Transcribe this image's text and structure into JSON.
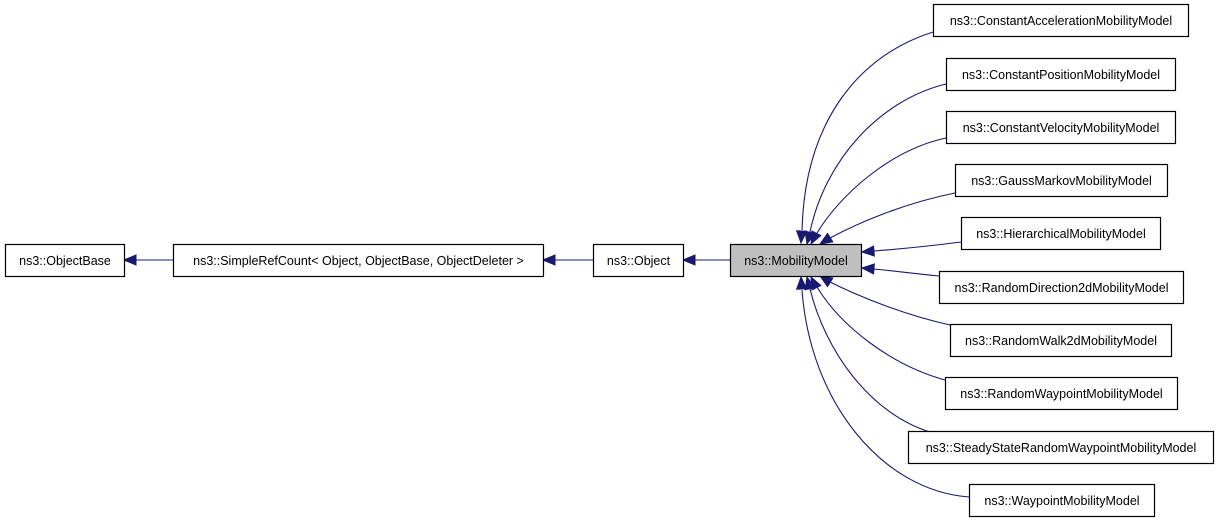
{
  "diagram": {
    "type": "class-inheritance-graph",
    "focus_class": "ns3::MobilityModel",
    "colors": {
      "edge": "#191970",
      "node_fill": "#ffffff",
      "focus_fill": "#bfbfbf",
      "node_border": "#000000"
    },
    "nodes": [
      {
        "id": "objectbase",
        "label": "ns3::ObjectBase"
      },
      {
        "id": "simplerefcount",
        "label": "ns3::SimpleRefCount< Object, ObjectBase, ObjectDeleter >"
      },
      {
        "id": "object",
        "label": "ns3::Object"
      },
      {
        "id": "mobilitymodel",
        "label": "ns3::MobilityModel",
        "focus": true
      },
      {
        "id": "constantacceleration",
        "label": "ns3::ConstantAccelerationMobilityModel"
      },
      {
        "id": "constantposition",
        "label": "ns3::ConstantPositionMobilityModel"
      },
      {
        "id": "constantvelocity",
        "label": "ns3::ConstantVelocityMobilityModel"
      },
      {
        "id": "gaussmarkov",
        "label": "ns3::GaussMarkovMobilityModel"
      },
      {
        "id": "hierarchical",
        "label": "ns3::HierarchicalMobilityModel"
      },
      {
        "id": "randomdirection2d",
        "label": "ns3::RandomDirection2dMobilityModel"
      },
      {
        "id": "randomwalk2d",
        "label": "ns3::RandomWalk2dMobilityModel"
      },
      {
        "id": "randomwaypoint",
        "label": "ns3::RandomWaypointMobilityModel"
      },
      {
        "id": "steadystaterandomwaypoint",
        "label": "ns3::SteadyStateRandomWaypointMobilityModel"
      },
      {
        "id": "waypoint",
        "label": "ns3::WaypointMobilityModel"
      }
    ],
    "edges": [
      {
        "from": "simplerefcount",
        "to": "objectbase",
        "relation": "inherits"
      },
      {
        "from": "object",
        "to": "simplerefcount",
        "relation": "inherits"
      },
      {
        "from": "mobilitymodel",
        "to": "object",
        "relation": "inherits"
      },
      {
        "from": "constantacceleration",
        "to": "mobilitymodel",
        "relation": "inherits"
      },
      {
        "from": "constantposition",
        "to": "mobilitymodel",
        "relation": "inherits"
      },
      {
        "from": "constantvelocity",
        "to": "mobilitymodel",
        "relation": "inherits"
      },
      {
        "from": "gaussmarkov",
        "to": "mobilitymodel",
        "relation": "inherits"
      },
      {
        "from": "hierarchical",
        "to": "mobilitymodel",
        "relation": "inherits"
      },
      {
        "from": "randomdirection2d",
        "to": "mobilitymodel",
        "relation": "inherits"
      },
      {
        "from": "randomwalk2d",
        "to": "mobilitymodel",
        "relation": "inherits"
      },
      {
        "from": "randomwaypoint",
        "to": "mobilitymodel",
        "relation": "inherits"
      },
      {
        "from": "steadystaterandomwaypoint",
        "to": "mobilitymodel",
        "relation": "inherits"
      },
      {
        "from": "waypoint",
        "to": "mobilitymodel",
        "relation": "inherits"
      }
    ]
  }
}
